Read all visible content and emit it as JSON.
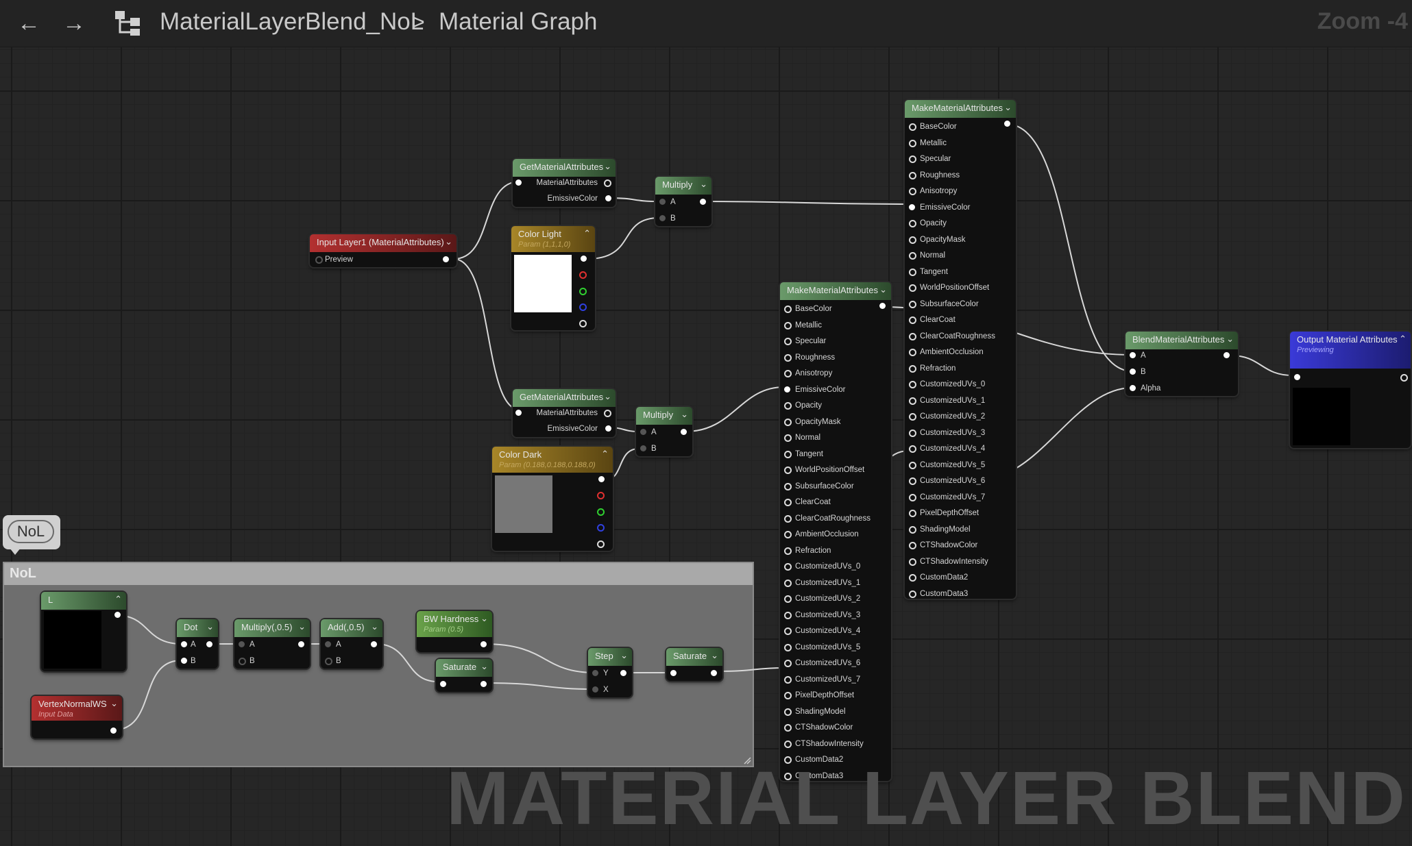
{
  "topbar": {
    "back_icon": "arrow-left-icon",
    "forward_icon": "arrow-right-icon",
    "graph_icon": "hierarchy-icon",
    "crumb_asset": "MaterialLayerBlend_NoL",
    "crumb_separator": ">",
    "crumb_graph": "Material Graph",
    "zoom": "Zoom -4"
  },
  "nodes": {
    "input_layer": {
      "title": "Input Layer1 (MaterialAttributes)",
      "pin_preview": "Preview"
    },
    "get1": {
      "title": "GetMaterialAttributes",
      "pin_ma": "MaterialAttributes",
      "pin_ec": "EmissiveColor"
    },
    "get2": {
      "title": "GetMaterialAttributes",
      "pin_ma": "MaterialAttributes",
      "pin_ec": "EmissiveColor"
    },
    "color_light": {
      "title": "Color Light",
      "sub": "Param (1,1,1,0)",
      "swatch": "#ffffff"
    },
    "color_dark": {
      "title": "Color Dark",
      "sub": "Param (0.188,0.188,0.188,0)",
      "swatch": "#777777"
    },
    "mul1": {
      "title": "Multiply",
      "a": "A",
      "b": "B"
    },
    "mul2": {
      "title": "Multiply",
      "a": "A",
      "b": "B"
    },
    "make1": {
      "title": "MakeMaterialAttributes",
      "pins": [
        "BaseColor",
        "Metallic",
        "Specular",
        "Roughness",
        "Anisotropy",
        "EmissiveColor",
        "Opacity",
        "OpacityMask",
        "Normal",
        "Tangent",
        "WorldPositionOffset",
        "SubsurfaceColor",
        "ClearCoat",
        "ClearCoatRoughness",
        "AmbientOcclusion",
        "Refraction",
        "CustomizedUVs_0",
        "CustomizedUVs_1",
        "CustomizedUVs_2",
        "CustomizedUVs_3",
        "CustomizedUVs_4",
        "CustomizedUVs_5",
        "CustomizedUVs_6",
        "CustomizedUVs_7",
        "PixelDepthOffset",
        "ShadingModel",
        "CTShadowColor",
        "CTShadowIntensity",
        "CustomData2",
        "CustomData3"
      ]
    },
    "make2": {
      "title": "MakeMaterialAttributes",
      "pins": [
        "BaseColor",
        "Metallic",
        "Specular",
        "Roughness",
        "Anisotropy",
        "EmissiveColor",
        "Opacity",
        "OpacityMask",
        "Normal",
        "Tangent",
        "WorldPositionOffset",
        "SubsurfaceColor",
        "ClearCoat",
        "ClearCoatRoughness",
        "AmbientOcclusion",
        "Refraction",
        "CustomizedUVs_0",
        "CustomizedUVs_1",
        "CustomizedUVs_2",
        "CustomizedUVs_3",
        "CustomizedUVs_4",
        "CustomizedUVs_5",
        "CustomizedUVs_6",
        "CustomizedUVs_7",
        "PixelDepthOffset",
        "ShadingModel",
        "CTShadowColor",
        "CTShadowIntensity",
        "CustomData2",
        "CustomData3"
      ]
    },
    "blend": {
      "title": "BlendMaterialAttributes",
      "a": "A",
      "b": "B",
      "alpha": "Alpha"
    },
    "output": {
      "title": "Output Material Attributes",
      "sub": "Previewing"
    },
    "l_param": {
      "title": "L"
    },
    "vnormal": {
      "title": "VertexNormalWS",
      "sub": "Input Data"
    },
    "dot": {
      "title": "Dot",
      "a": "A",
      "b": "B"
    },
    "mul05": {
      "title": "Multiply(,0.5)",
      "a": "A",
      "b": "B"
    },
    "add05": {
      "title": "Add(,0.5)",
      "a": "A",
      "b": "B"
    },
    "bw": {
      "title": "BW Hardness",
      "sub": "Param (0.5)"
    },
    "sat1": {
      "title": "Saturate"
    },
    "step": {
      "title": "Step",
      "y": "Y",
      "x": "X"
    },
    "sat2": {
      "title": "Saturate"
    }
  },
  "comment": {
    "bubble": "NoL",
    "title": "NoL"
  },
  "watermark": "MATERIAL LAYER BLEND",
  "colors": {
    "pin_red": "#e03030",
    "pin_green": "#30d030",
    "pin_blue": "#3040e0",
    "wire": "#d8d8d8"
  }
}
